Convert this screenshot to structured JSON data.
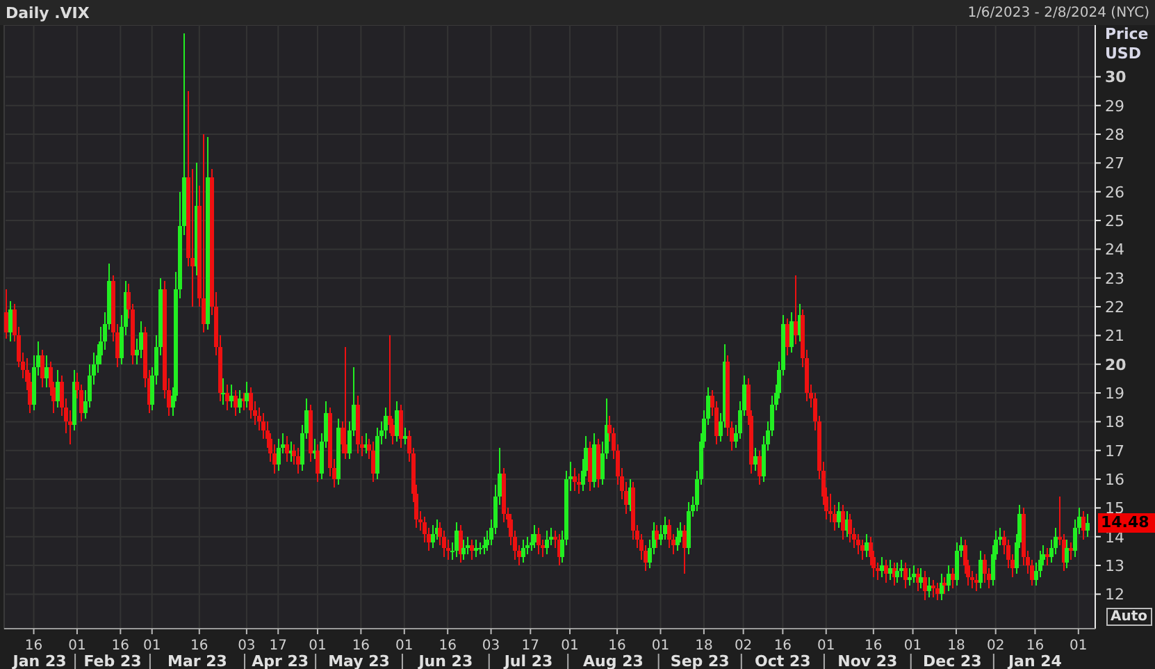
{
  "header": {
    "title": "Daily .VIX",
    "date_range": "1/6/2023 - 2/8/2024 (NYC)"
  },
  "chart": {
    "axis_title": [
      "Price",
      "USD"
    ],
    "last_price": "14.48",
    "scale_button": "Auto",
    "months": [
      "Jan 23",
      "Feb 23",
      "Mar 23",
      "Apr 23",
      "May 23",
      "Jun 23",
      "Jul 23",
      "Aug 23",
      "Sep 23",
      "Oct 23",
      "Nov 23",
      "Dec 23",
      "Jan 24"
    ],
    "chart_data": {
      "type": "candlestick",
      "grid": true,
      "ylim": [
        10.8,
        31.8
      ],
      "yticks": [
        12,
        13,
        14,
        15,
        16,
        17,
        18,
        19,
        20,
        21,
        22,
        23,
        24,
        25,
        26,
        27,
        28,
        29,
        30
      ],
      "categories": [
        null,
        null,
        null,
        null,
        null,
        null,
        null,
        "16",
        null,
        null,
        null,
        null,
        null,
        null,
        null,
        null,
        null,
        null,
        "01",
        null,
        null,
        null,
        null,
        null,
        null,
        null,
        null,
        null,
        null,
        "16",
        null,
        null,
        null,
        null,
        null,
        null,
        null,
        "01",
        null,
        null,
        null,
        null,
        null,
        null,
        null,
        null,
        null,
        null,
        null,
        "16",
        null,
        null,
        null,
        null,
        null,
        null,
        null,
        null,
        null,
        null,
        null,
        "03",
        null,
        null,
        null,
        null,
        null,
        null,
        null,
        "17",
        null,
        null,
        null,
        null,
        null,
        null,
        null,
        null,
        null,
        "01",
        null,
        null,
        null,
        null,
        null,
        null,
        null,
        null,
        null,
        null,
        "16",
        null,
        null,
        null,
        null,
        null,
        null,
        null,
        null,
        null,
        null,
        "01",
        null,
        null,
        null,
        null,
        null,
        null,
        null,
        null,
        null,
        null,
        "16",
        null,
        null,
        null,
        null,
        null,
        null,
        null,
        null,
        null,
        null,
        "03",
        null,
        null,
        null,
        null,
        null,
        null,
        null,
        null,
        null,
        "17",
        null,
        null,
        null,
        null,
        null,
        null,
        null,
        null,
        null,
        "01",
        null,
        null,
        null,
        null,
        null,
        null,
        null,
        null,
        null,
        null,
        null,
        "16",
        null,
        null,
        null,
        null,
        null,
        null,
        null,
        null,
        null,
        null,
        "01",
        null,
        null,
        null,
        null,
        null,
        null,
        null,
        null,
        null,
        null,
        "18",
        null,
        null,
        null,
        null,
        null,
        null,
        null,
        null,
        null,
        "02",
        null,
        null,
        null,
        null,
        null,
        null,
        null,
        null,
        null,
        "16",
        null,
        null,
        null,
        null,
        null,
        null,
        null,
        null,
        null,
        null,
        "01",
        null,
        null,
        null,
        null,
        null,
        null,
        null,
        null,
        null,
        null,
        null,
        "16",
        null,
        null,
        null,
        null,
        null,
        null,
        null,
        null,
        null,
        "01",
        null,
        null,
        null,
        null,
        null,
        null,
        null,
        null,
        null,
        null,
        "18",
        null,
        null,
        null,
        null,
        null,
        null,
        null,
        null,
        null,
        "02",
        null,
        null,
        null,
        null,
        null,
        null,
        null,
        null,
        null,
        "16",
        null,
        null,
        null,
        null,
        null,
        null,
        null,
        null,
        null,
        null,
        "01",
        null,
        null
      ],
      "ohlc": [
        [
          21.8,
          22.6,
          20.9,
          21.1
        ],
        [
          21.1,
          22.2,
          20.8,
          21.9
        ],
        [
          21.9,
          22.1,
          20.8,
          21.0
        ],
        [
          21.0,
          21.3,
          19.9,
          20.1
        ],
        [
          20.1,
          20.4,
          19.5,
          19.8
        ],
        [
          19.8,
          20.2,
          19.1,
          19.4
        ],
        [
          19.4,
          19.7,
          18.3,
          18.6
        ],
        [
          18.6,
          20.3,
          18.4,
          19.9
        ],
        [
          19.9,
          20.8,
          19.6,
          20.3
        ],
        [
          20.3,
          20.5,
          19.2,
          19.5
        ],
        [
          19.5,
          20.3,
          19.2,
          19.9
        ],
        [
          19.9,
          20.1,
          18.9,
          19.2
        ],
        [
          19.2,
          19.4,
          18.3,
          18.7
        ],
        [
          18.7,
          19.8,
          18.5,
          19.4
        ],
        [
          19.4,
          19.6,
          18.2,
          18.5
        ],
        [
          18.5,
          18.8,
          17.6,
          18.0
        ],
        [
          18.0,
          18.4,
          17.2,
          17.9
        ],
        [
          17.9,
          19.8,
          17.7,
          19.4
        ],
        [
          19.4,
          19.7,
          18.8,
          19.1
        ],
        [
          19.1,
          19.3,
          18.0,
          18.3
        ],
        [
          18.3,
          19.1,
          18.1,
          18.7
        ],
        [
          18.7,
          20.0,
          18.5,
          19.6
        ],
        [
          19.6,
          20.4,
          19.3,
          20.0
        ],
        [
          20.0,
          20.7,
          19.7,
          20.3
        ],
        [
          20.3,
          21.3,
          20.0,
          20.8
        ],
        [
          20.8,
          21.8,
          20.5,
          21.4
        ],
        [
          21.4,
          23.5,
          21.2,
          22.9
        ],
        [
          22.9,
          23.1,
          20.8,
          21.1
        ],
        [
          21.1,
          21.4,
          19.9,
          20.2
        ],
        [
          20.2,
          21.7,
          20.0,
          21.3
        ],
        [
          21.3,
          22.9,
          21.0,
          22.5
        ],
        [
          22.5,
          22.8,
          21.6,
          21.9
        ],
        [
          21.9,
          22.1,
          20.0,
          20.3
        ],
        [
          20.3,
          20.9,
          20.0,
          20.5
        ],
        [
          20.5,
          21.5,
          20.2,
          21.1
        ],
        [
          21.1,
          21.3,
          19.2,
          19.5
        ],
        [
          19.5,
          19.8,
          18.3,
          18.6
        ],
        [
          18.6,
          19.9,
          18.4,
          19.6
        ],
        [
          19.6,
          21.0,
          19.3,
          20.6
        ],
        [
          20.6,
          23.0,
          20.3,
          22.6
        ],
        [
          22.6,
          22.9,
          18.8,
          19.1
        ],
        [
          19.1,
          19.5,
          18.2,
          18.5
        ],
        [
          18.5,
          19.2,
          18.2,
          18.9
        ],
        [
          18.9,
          23.2,
          18.7,
          22.6
        ],
        [
          22.6,
          26.0,
          22.3,
          24.8
        ],
        [
          24.8,
          31.5,
          24.5,
          26.5
        ],
        [
          26.5,
          29.5,
          23.4,
          23.7
        ],
        [
          23.7,
          26.8,
          22.0,
          23.4
        ],
        [
          23.4,
          27.0,
          23.1,
          25.5
        ],
        [
          25.5,
          26.2,
          22.0,
          22.3
        ],
        [
          22.3,
          28.0,
          21.1,
          21.4
        ],
        [
          21.4,
          27.9,
          21.2,
          26.5
        ],
        [
          26.5,
          26.8,
          21.7,
          22.0
        ],
        [
          22.0,
          22.5,
          20.3,
          20.6
        ],
        [
          20.6,
          21.0,
          18.7,
          19.0
        ],
        [
          19.0,
          19.5,
          18.6,
          19.0
        ],
        [
          19.0,
          19.3,
          18.4,
          18.7
        ],
        [
          18.7,
          19.3,
          18.5,
          18.9
        ],
        [
          18.9,
          19.1,
          18.2,
          18.5
        ],
        [
          18.5,
          19.1,
          18.3,
          18.8
        ],
        [
          18.8,
          19.0,
          18.4,
          18.7
        ],
        [
          18.7,
          19.4,
          18.5,
          19.0
        ],
        [
          19.0,
          19.2,
          18.1,
          18.4
        ],
        [
          18.4,
          18.7,
          17.9,
          18.2
        ],
        [
          18.2,
          18.5,
          17.7,
          18.0
        ],
        [
          18.0,
          18.3,
          17.4,
          17.7
        ],
        [
          17.7,
          18.0,
          17.1,
          17.4
        ],
        [
          17.4,
          17.6,
          16.6,
          16.9
        ],
        [
          16.9,
          17.2,
          16.2,
          16.5
        ],
        [
          16.5,
          17.4,
          16.3,
          17.1
        ],
        [
          17.1,
          17.6,
          16.9,
          17.2
        ],
        [
          17.2,
          17.5,
          16.6,
          16.9
        ],
        [
          16.9,
          17.3,
          16.6,
          17.0
        ],
        [
          17.0,
          17.2,
          16.5,
          16.8
        ],
        [
          16.8,
          17.1,
          16.2,
          16.5
        ],
        [
          16.5,
          17.9,
          16.3,
          17.6
        ],
        [
          17.6,
          18.8,
          17.4,
          18.4
        ],
        [
          18.4,
          18.6,
          16.6,
          16.9
        ],
        [
          16.9,
          17.4,
          16.7,
          17.0
        ],
        [
          17.0,
          17.2,
          15.9,
          16.2
        ],
        [
          16.2,
          17.6,
          16.0,
          17.3
        ],
        [
          17.3,
          18.7,
          17.1,
          18.3
        ],
        [
          18.3,
          18.5,
          16.1,
          16.4
        ],
        [
          16.4,
          16.7,
          15.7,
          16.0
        ],
        [
          16.0,
          18.1,
          15.8,
          17.8
        ],
        [
          17.8,
          18.0,
          16.9,
          17.2
        ],
        [
          17.2,
          20.6,
          16.7,
          16.9
        ],
        [
          16.9,
          18.0,
          16.7,
          17.7
        ],
        [
          17.7,
          19.9,
          17.5,
          18.6
        ],
        [
          18.6,
          18.9,
          16.9,
          17.2
        ],
        [
          17.2,
          17.5,
          16.8,
          17.1
        ],
        [
          17.1,
          17.6,
          16.9,
          17.2
        ],
        [
          17.2,
          17.4,
          16.7,
          17.0
        ],
        [
          17.0,
          17.3,
          15.9,
          16.2
        ],
        [
          16.2,
          17.8,
          16.0,
          17.5
        ],
        [
          17.5,
          18.0,
          17.2,
          17.7
        ],
        [
          17.7,
          18.5,
          17.4,
          18.2
        ],
        [
          18.2,
          21.0,
          17.6,
          17.9
        ],
        [
          17.9,
          18.1,
          17.2,
          17.5
        ],
        [
          17.5,
          18.7,
          17.3,
          18.4
        ],
        [
          18.4,
          18.6,
          17.1,
          17.4
        ],
        [
          17.4,
          17.8,
          17.2,
          17.5
        ],
        [
          17.5,
          17.7,
          16.6,
          16.9
        ],
        [
          16.9,
          17.1,
          15.2,
          15.5
        ],
        [
          15.5,
          15.8,
          14.3,
          14.6
        ],
        [
          14.6,
          14.9,
          14.2,
          14.5
        ],
        [
          14.5,
          14.7,
          13.8,
          14.1
        ],
        [
          14.1,
          14.3,
          13.5,
          13.8
        ],
        [
          13.8,
          14.4,
          13.6,
          14.1
        ],
        [
          14.1,
          14.6,
          13.9,
          14.3
        ],
        [
          14.3,
          14.5,
          13.7,
          14.0
        ],
        [
          14.0,
          14.2,
          13.3,
          13.6
        ],
        [
          13.6,
          13.9,
          13.2,
          13.5
        ],
        [
          13.5,
          13.8,
          13.2,
          13.5
        ],
        [
          13.5,
          14.5,
          13.3,
          14.2
        ],
        [
          14.2,
          14.4,
          13.1,
          13.4
        ],
        [
          13.4,
          13.9,
          13.2,
          13.6
        ],
        [
          13.6,
          14.0,
          13.4,
          13.7
        ],
        [
          13.7,
          13.9,
          13.2,
          13.5
        ],
        [
          13.5,
          13.9,
          13.3,
          13.6
        ],
        [
          13.6,
          13.8,
          13.4,
          13.6
        ],
        [
          13.6,
          14.0,
          13.4,
          13.7
        ],
        [
          13.7,
          14.2,
          13.5,
          13.9
        ],
        [
          13.9,
          14.6,
          13.7,
          14.3
        ],
        [
          14.3,
          15.8,
          14.1,
          15.4
        ],
        [
          15.4,
          17.1,
          15.1,
          16.2
        ],
        [
          16.2,
          16.4,
          14.5,
          14.8
        ],
        [
          14.8,
          15.0,
          14.3,
          14.6
        ],
        [
          14.6,
          14.8,
          13.7,
          14.0
        ],
        [
          14.0,
          14.2,
          13.2,
          13.5
        ],
        [
          13.5,
          13.7,
          13.0,
          13.3
        ],
        [
          13.3,
          13.9,
          13.1,
          13.6
        ],
        [
          13.6,
          14.0,
          13.4,
          13.7
        ],
        [
          13.7,
          14.1,
          13.5,
          13.8
        ],
        [
          13.8,
          14.4,
          13.6,
          14.1
        ],
        [
          14.1,
          14.3,
          13.4,
          13.7
        ],
        [
          13.7,
          13.9,
          13.3,
          13.6
        ],
        [
          13.6,
          14.2,
          13.4,
          13.9
        ],
        [
          13.9,
          14.3,
          13.7,
          14.0
        ],
        [
          14.0,
          14.2,
          13.6,
          13.9
        ],
        [
          13.9,
          14.1,
          13.0,
          13.3
        ],
        [
          13.3,
          14.2,
          13.1,
          13.9
        ],
        [
          13.9,
          16.3,
          13.7,
          16.0
        ],
        [
          16.0,
          16.6,
          15.6,
          16.1
        ],
        [
          16.1,
          16.4,
          15.6,
          15.9
        ],
        [
          15.9,
          16.2,
          15.5,
          15.8
        ],
        [
          15.8,
          16.7,
          15.6,
          16.3
        ],
        [
          16.3,
          17.5,
          16.1,
          17.1
        ],
        [
          17.1,
          17.3,
          15.6,
          15.9
        ],
        [
          15.9,
          17.6,
          15.7,
          17.2
        ],
        [
          17.2,
          17.4,
          15.7,
          16.0
        ],
        [
          16.0,
          17.3,
          15.8,
          16.9
        ],
        [
          16.9,
          18.8,
          16.7,
          17.9
        ],
        [
          17.9,
          18.2,
          17.3,
          17.6
        ],
        [
          17.6,
          17.8,
          16.7,
          17.0
        ],
        [
          17.0,
          17.2,
          15.8,
          16.1
        ],
        [
          16.1,
          16.4,
          15.3,
          15.6
        ],
        [
          15.6,
          15.9,
          14.8,
          15.1
        ],
        [
          15.1,
          16.0,
          14.9,
          15.7
        ],
        [
          15.7,
          15.9,
          13.9,
          14.2
        ],
        [
          14.2,
          14.4,
          13.6,
          13.9
        ],
        [
          13.9,
          14.1,
          13.2,
          13.5
        ],
        [
          13.5,
          13.7,
          12.8,
          13.1
        ],
        [
          13.1,
          13.9,
          12.9,
          13.6
        ],
        [
          13.6,
          14.5,
          13.4,
          14.2
        ],
        [
          14.2,
          14.4,
          13.6,
          13.9
        ],
        [
          13.9,
          14.4,
          13.7,
          14.1
        ],
        [
          14.1,
          14.7,
          13.9,
          14.4
        ],
        [
          14.4,
          14.6,
          13.6,
          13.9
        ],
        [
          13.9,
          14.1,
          13.4,
          13.7
        ],
        [
          13.7,
          14.3,
          13.5,
          14.0
        ],
        [
          14.0,
          14.5,
          13.8,
          14.2
        ],
        [
          14.2,
          14.4,
          12.7,
          13.6
        ],
        [
          13.6,
          15.2,
          13.4,
          14.9
        ],
        [
          14.9,
          15.4,
          14.7,
          15.1
        ],
        [
          15.1,
          16.3,
          14.9,
          16.0
        ],
        [
          16.0,
          17.6,
          15.8,
          17.3
        ],
        [
          17.3,
          18.4,
          17.1,
          18.1
        ],
        [
          18.1,
          19.2,
          17.9,
          18.9
        ],
        [
          18.9,
          19.1,
          18.2,
          18.5
        ],
        [
          18.5,
          18.7,
          17.2,
          17.5
        ],
        [
          17.5,
          18.3,
          17.3,
          18.0
        ],
        [
          18.0,
          20.7,
          17.8,
          20.1
        ],
        [
          20.1,
          20.3,
          17.5,
          17.8
        ],
        [
          17.8,
          18.0,
          17.0,
          17.3
        ],
        [
          17.3,
          17.9,
          17.1,
          17.6
        ],
        [
          17.6,
          18.7,
          17.4,
          18.4
        ],
        [
          18.4,
          19.6,
          18.2,
          19.3
        ],
        [
          19.3,
          19.5,
          17.9,
          18.2
        ],
        [
          18.2,
          18.4,
          16.2,
          16.5
        ],
        [
          16.5,
          17.1,
          16.3,
          16.8
        ],
        [
          16.8,
          17.0,
          15.8,
          16.1
        ],
        [
          16.1,
          17.5,
          15.9,
          17.2
        ],
        [
          17.2,
          18.0,
          17.0,
          17.7
        ],
        [
          17.7,
          18.9,
          17.5,
          18.6
        ],
        [
          18.6,
          19.3,
          18.4,
          19.0
        ],
        [
          19.0,
          20.1,
          18.8,
          19.8
        ],
        [
          19.8,
          21.7,
          19.6,
          21.4
        ],
        [
          21.4,
          21.6,
          20.3,
          20.6
        ],
        [
          20.6,
          21.8,
          20.4,
          21.5
        ],
        [
          21.5,
          23.1,
          20.7,
          21.0
        ],
        [
          21.0,
          22.1,
          20.8,
          21.7
        ],
        [
          21.7,
          21.9,
          19.9,
          20.2
        ],
        [
          20.2,
          20.5,
          18.7,
          19.0
        ],
        [
          19.0,
          19.3,
          18.5,
          18.8
        ],
        [
          18.8,
          19.0,
          17.7,
          18.0
        ],
        [
          18.0,
          18.2,
          16.0,
          16.3
        ],
        [
          16.3,
          16.6,
          15.1,
          15.4
        ],
        [
          15.4,
          15.7,
          14.6,
          14.9
        ],
        [
          14.9,
          15.5,
          14.5,
          14.8
        ],
        [
          14.8,
          15.1,
          14.2,
          14.5
        ],
        [
          14.5,
          15.2,
          14.3,
          14.9
        ],
        [
          14.9,
          15.1,
          13.9,
          14.2
        ],
        [
          14.2,
          14.9,
          14.0,
          14.6
        ],
        [
          14.6,
          14.8,
          13.8,
          14.1
        ],
        [
          14.1,
          14.3,
          13.6,
          13.9
        ],
        [
          13.9,
          14.1,
          13.4,
          13.7
        ],
        [
          13.7,
          13.9,
          13.2,
          13.5
        ],
        [
          13.5,
          14.1,
          13.3,
          13.8
        ],
        [
          13.8,
          14.0,
          13.0,
          13.3
        ],
        [
          13.3,
          13.5,
          12.6,
          12.9
        ],
        [
          12.9,
          13.1,
          12.5,
          12.8
        ],
        [
          12.8,
          13.3,
          12.6,
          13.0
        ],
        [
          13.0,
          13.2,
          12.4,
          12.7
        ],
        [
          12.7,
          13.2,
          12.5,
          12.9
        ],
        [
          12.9,
          13.1,
          12.3,
          12.6
        ],
        [
          12.6,
          13.1,
          12.4,
          12.8
        ],
        [
          12.8,
          13.2,
          12.6,
          12.9
        ],
        [
          12.9,
          13.1,
          12.2,
          12.5
        ],
        [
          12.5,
          12.9,
          12.3,
          12.6
        ],
        [
          12.6,
          13.0,
          12.4,
          12.7
        ],
        [
          12.7,
          12.9,
          12.1,
          12.4
        ],
        [
          12.4,
          12.9,
          12.2,
          12.6
        ],
        [
          12.6,
          12.8,
          11.8,
          12.1
        ],
        [
          12.1,
          12.6,
          11.9,
          12.3
        ],
        [
          12.3,
          12.5,
          11.9,
          12.2
        ],
        [
          12.2,
          12.4,
          11.8,
          12.0
        ],
        [
          12.0,
          12.7,
          11.8,
          12.4
        ],
        [
          12.4,
          12.6,
          12.0,
          12.3
        ],
        [
          12.3,
          13.0,
          12.1,
          12.7
        ],
        [
          12.7,
          12.9,
          12.2,
          12.5
        ],
        [
          12.5,
          13.8,
          12.3,
          13.5
        ],
        [
          13.5,
          14.0,
          13.3,
          13.7
        ],
        [
          13.7,
          13.9,
          12.7,
          13.0
        ],
        [
          13.0,
          13.2,
          12.3,
          12.6
        ],
        [
          12.6,
          12.8,
          12.2,
          12.5
        ],
        [
          12.5,
          12.7,
          12.1,
          12.4
        ],
        [
          12.4,
          13.5,
          12.2,
          13.2
        ],
        [
          13.2,
          13.4,
          12.4,
          12.7
        ],
        [
          12.7,
          12.9,
          12.2,
          12.5
        ],
        [
          12.5,
          13.7,
          12.3,
          13.4
        ],
        [
          13.4,
          14.2,
          13.2,
          13.9
        ],
        [
          13.9,
          14.3,
          13.7,
          14.0
        ],
        [
          14.0,
          14.2,
          13.4,
          13.7
        ],
        [
          13.7,
          13.9,
          12.9,
          13.2
        ],
        [
          13.2,
          13.4,
          12.6,
          12.9
        ],
        [
          12.9,
          14.1,
          12.7,
          13.8
        ],
        [
          13.8,
          15.1,
          13.6,
          14.8
        ],
        [
          14.8,
          15.0,
          13.0,
          13.3
        ],
        [
          13.3,
          13.5,
          12.7,
          13.0
        ],
        [
          13.0,
          13.2,
          12.3,
          12.5
        ],
        [
          12.5,
          13.1,
          12.3,
          12.8
        ],
        [
          12.8,
          13.5,
          12.6,
          13.2
        ],
        [
          13.2,
          13.7,
          13.0,
          13.4
        ],
        [
          13.4,
          13.6,
          13.0,
          13.3
        ],
        [
          13.3,
          13.9,
          13.1,
          13.6
        ],
        [
          13.6,
          14.3,
          13.4,
          14.0
        ],
        [
          14.0,
          15.4,
          13.7,
          13.9
        ],
        [
          13.9,
          14.1,
          12.8,
          13.1
        ],
        [
          13.1,
          13.9,
          12.9,
          13.6
        ],
        [
          13.6,
          13.8,
          13.2,
          13.5
        ],
        [
          13.5,
          14.6,
          13.3,
          14.3
        ],
        [
          14.3,
          15.0,
          14.1,
          14.7
        ],
        [
          14.7,
          14.9,
          13.9,
          14.2
        ],
        [
          14.2,
          14.8,
          14.0,
          14.48
        ]
      ]
    }
  }
}
